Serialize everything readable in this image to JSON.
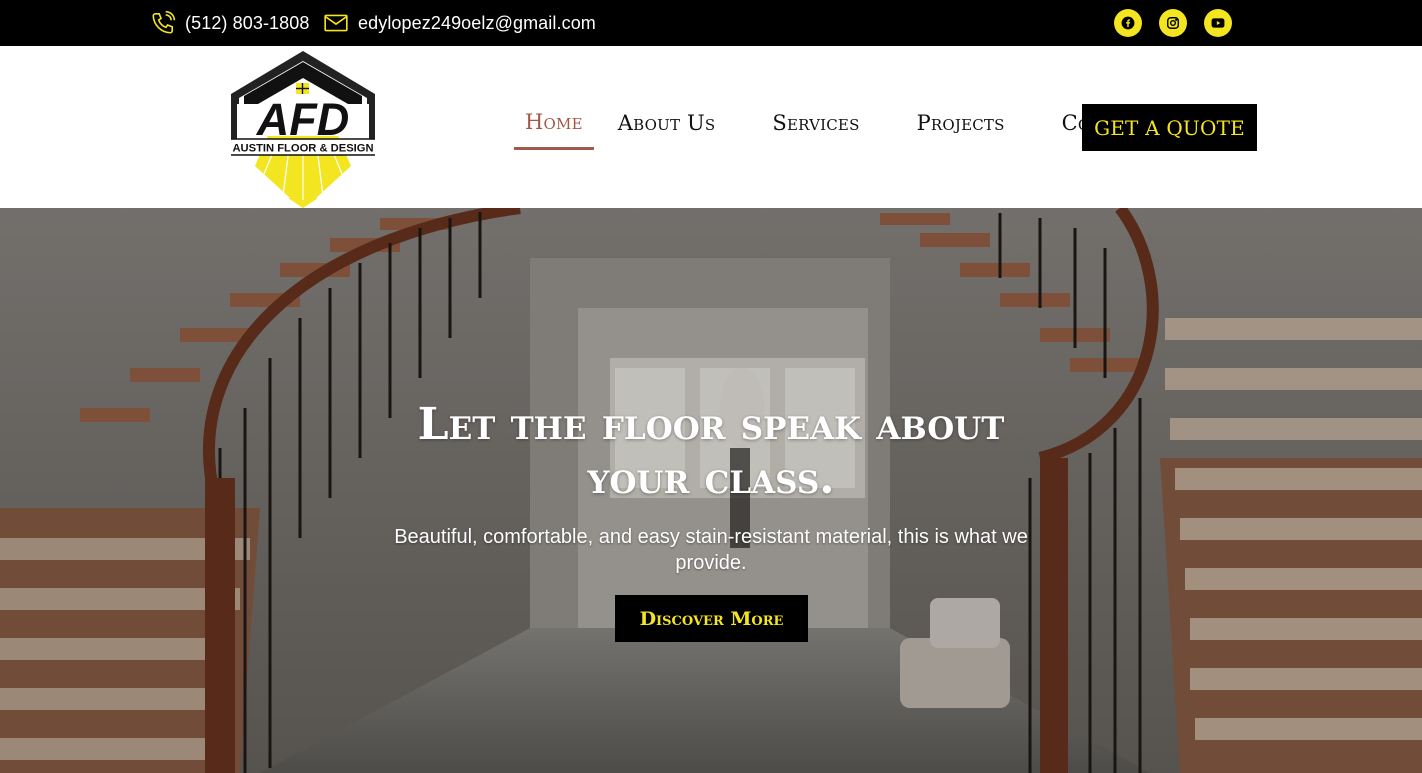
{
  "topbar": {
    "phone": "(512) 803-1808",
    "email": "edylopez249oelz@gmail.com",
    "social_icons": [
      "facebook-icon",
      "instagram-icon",
      "youtube-icon"
    ]
  },
  "logo": {
    "abbr": "AFD",
    "name": "AUSTIN FLOOR & DESIGN"
  },
  "nav": {
    "items": [
      {
        "label": "Home",
        "active": true
      },
      {
        "label": "About Us"
      },
      {
        "label": "Services"
      },
      {
        "label": "Projects"
      },
      {
        "label": "Contact Us"
      }
    ],
    "cta": "GET A QUOTE"
  },
  "hero": {
    "title_line1": "Let the floor speak about",
    "title_line2": "your class.",
    "subtitle": "Beautiful, comfortable, and easy stain-resistant material, this is what we provide.",
    "button": "Discover More"
  },
  "colors": {
    "accent": "#f3e520",
    "nav_active": "#a2584a",
    "dark": "#000000"
  }
}
